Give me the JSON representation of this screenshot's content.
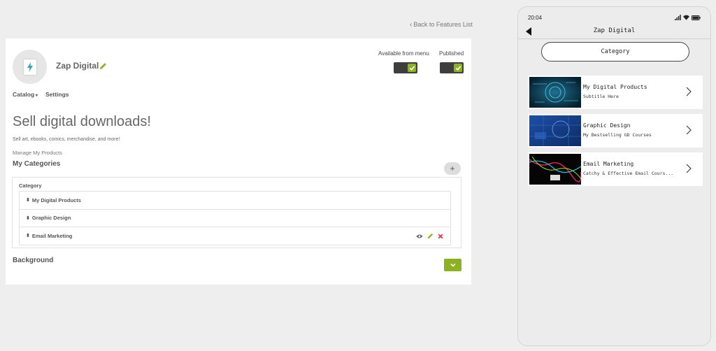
{
  "back_link": {
    "label": "Back to Features List"
  },
  "app": {
    "title": "Zap Digital"
  },
  "toggles": [
    {
      "label": "Available from menu",
      "on": true
    },
    {
      "label": "Published",
      "on": true
    }
  ],
  "subnav": {
    "catalog": "Catalog",
    "settings": "Settings"
  },
  "main": {
    "headline": "Sell digital downloads!",
    "tagline": "Sell art, ebooks, comics, merchandise, and more!",
    "manage_label": "Manage My Products",
    "categories_title": "My Categories",
    "add_label": "+",
    "category_header": "Category",
    "categories": [
      "My Digital Products",
      "Graphic Design",
      "Email Marketing"
    ],
    "background_title": "Background"
  },
  "phone": {
    "time": "20:04",
    "title": "Zap Digital",
    "category_button": "Category",
    "items": [
      {
        "title": "My Digital Products",
        "subtitle": "Subtitle Here"
      },
      {
        "title": "Graphic Design",
        "subtitle": "My Bestselling GD Courses"
      },
      {
        "title": "Email Marketing",
        "subtitle": "Catchy & Effective Email Cours..."
      }
    ]
  },
  "colors": {
    "accent": "#8cb31f",
    "danger": "#d9344f",
    "toggle_track": "#3e3e3e"
  }
}
